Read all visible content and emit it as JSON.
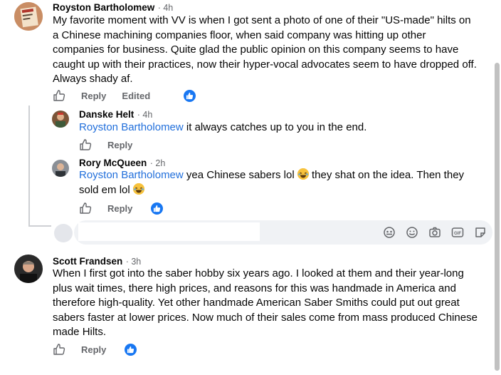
{
  "comments": [
    {
      "author": "Royston Bartholomew",
      "time": "· 4h",
      "text": "My favorite moment with VV is when I got sent a photo of one of their \"US-made\" hilts on a Chinese machining companies floor, when said company was hitting up other companies for business. Quite glad the public opinion on this company seems to have caught up with their practices, now their hyper-vocal advocates seem to have dropped off. Always shady af.",
      "actions": {
        "reply": "Reply",
        "edited": "Edited"
      }
    },
    {
      "author": "Danske Helt",
      "time": "· 4h",
      "mention": "Royston Bartholomew",
      "text": " it always catches up to you in the end.",
      "actions": {
        "reply": "Reply"
      }
    },
    {
      "author": "Rory McQueen",
      "time": "· 2h",
      "mention": "Royston Bartholomew",
      "text_a": " yea Chinese sabers lol ",
      "text_b": " they shat on the idea. Then they sold em lol ",
      "actions": {
        "reply": "Reply"
      }
    },
    {
      "author": "Scott Frandsen",
      "time": "· 3h",
      "text": "When I first got into the saber hobby  six years ago. I looked at them and their year-long plus wait times, there high prices, and reasons for this was handmade in America and therefore high-quality. Yet other handmade American Saber Smiths could put out great sabers faster at lower prices. Now  much of their sales come from mass produced Chinese made Hilts.",
      "actions": {
        "reply": "Reply"
      }
    }
  ],
  "composer": {
    "icons": [
      "avatar-sticker-icon",
      "emoji-icon",
      "camera-icon",
      "gif-icon",
      "sticker-icon"
    ]
  },
  "colors": {
    "accent": "#1877f2",
    "mention": "#216fdb",
    "muted": "#65676b",
    "composer_bg": "#f0f2f5"
  }
}
